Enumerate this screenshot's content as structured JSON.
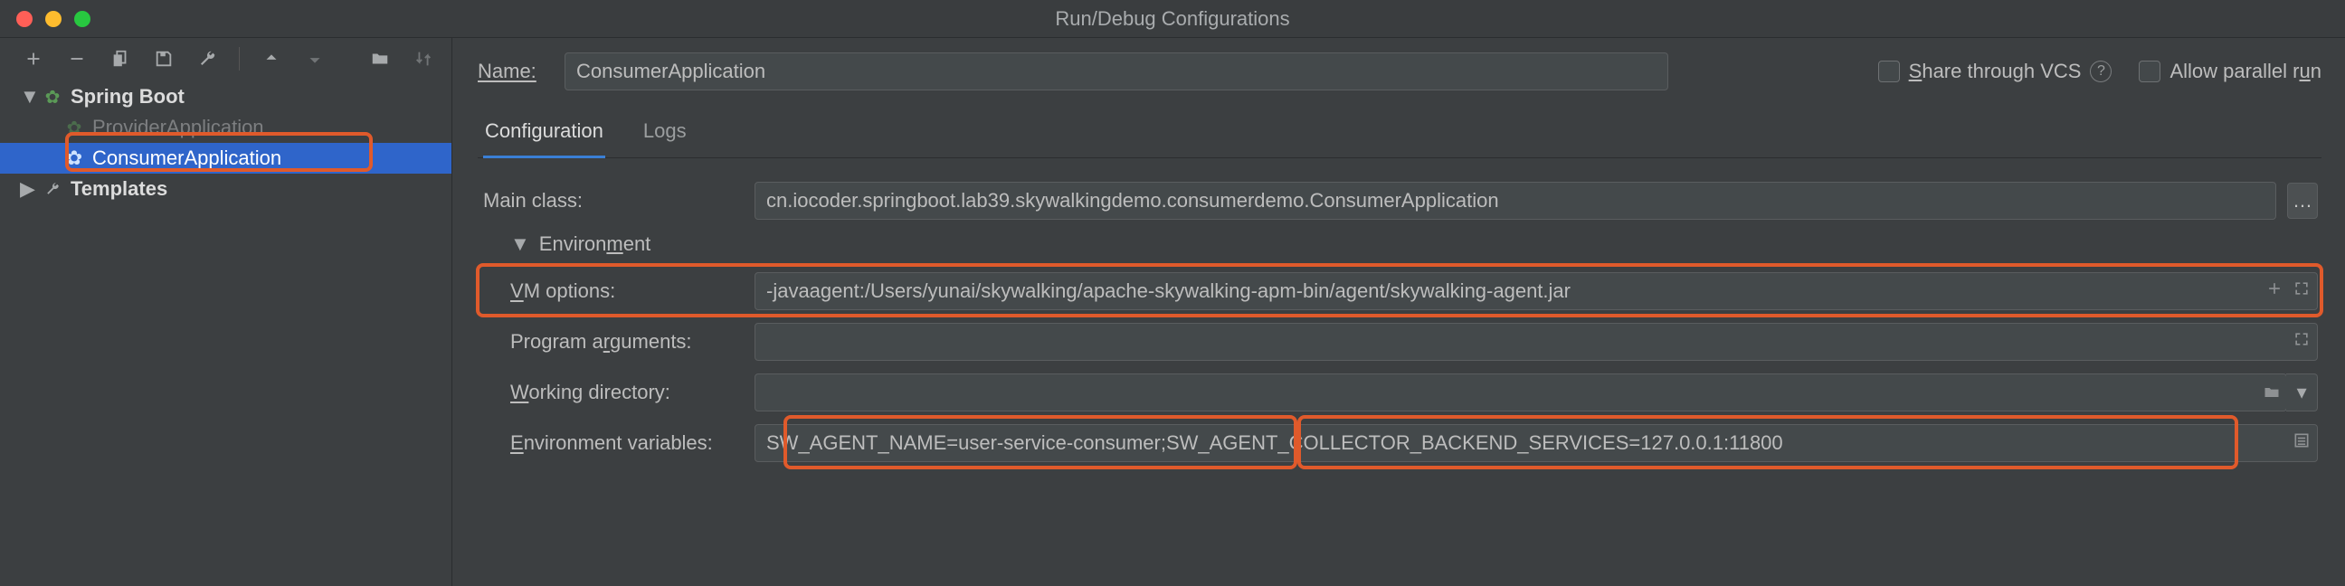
{
  "window": {
    "title": "Run/Debug Configurations"
  },
  "sidebar": {
    "root": {
      "label": "Spring Boot"
    },
    "items": [
      {
        "label": "ProviderApplication"
      },
      {
        "label": "ConsumerApplication"
      }
    ],
    "templates": {
      "label": "Templates"
    }
  },
  "top": {
    "name_label": "Name:",
    "name_value": "ConsumerApplication",
    "share_label": "Share through VCS",
    "parallel_label": "Allow parallel run"
  },
  "tabs": {
    "configuration": "Configuration",
    "logs": "Logs"
  },
  "form": {
    "main_class": {
      "label": "Main class:",
      "value": "cn.iocoder.springboot.lab39.skywalkingdemo.consumerdemo.ConsumerApplication"
    },
    "environment_section": "Environment",
    "vm_options": {
      "label": "VM options:",
      "value": "-javaagent:/Users/yunai/skywalking/apache-skywalking-apm-bin/agent/skywalking-agent.jar"
    },
    "program_args": {
      "label": "Program arguments:",
      "value": ""
    },
    "working_dir": {
      "label": "Working directory:",
      "value": ""
    },
    "env_vars": {
      "label": "Environment variables:",
      "value": "SW_AGENT_NAME=user-service-consumer;SW_AGENT_COLLECTOR_BACKEND_SERVICES=127.0.0.1:11800"
    }
  }
}
